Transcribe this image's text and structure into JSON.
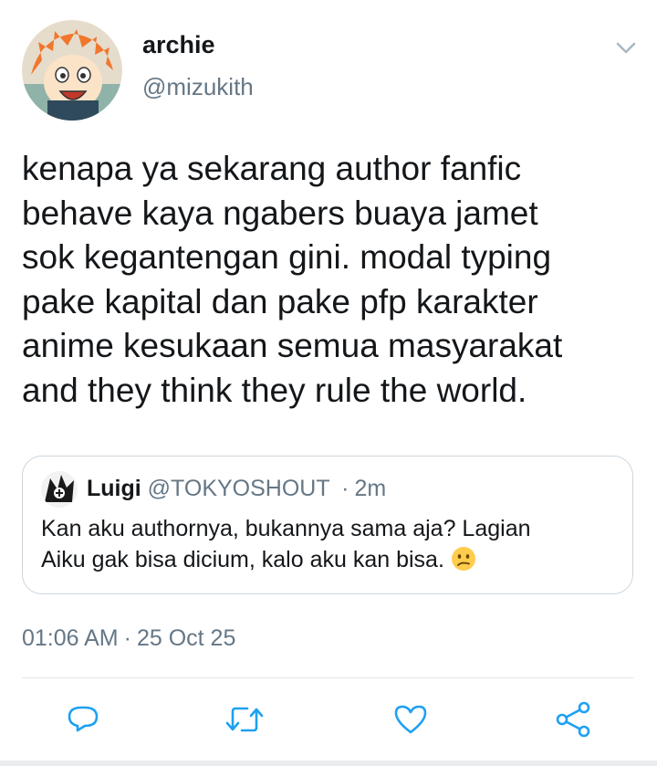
{
  "author": {
    "display_name": "archie",
    "handle": "@mizukith"
  },
  "tweet": {
    "text": "kenapa ya sekarang author fanfic\nbehave kaya ngabers buaya jamet\nsok kegantengan gini. modal typing\npake kapital dan pake pfp karakter\nanime kesukaan semua masyarakat\nand they think they rule the world.",
    "time": "01:06 AM",
    "meta_sep": "·",
    "date": "25 Oct 25"
  },
  "quoted": {
    "name": "Luigi",
    "handle": "@TOKYOSHOUT",
    "sep": "·",
    "age": "2m",
    "text": "Kan aku authornya, bukannya sama aja? Lagian\nAiku gak bisa dicium, kalo aku kan bisa. ",
    "emoji": "confused-face-emoji"
  },
  "actions": {
    "reply_icon": "reply-icon",
    "retweet_icon": "retweet-icon",
    "like_icon": "heart-icon",
    "share_icon": "share-icon"
  },
  "colors": {
    "text": "#14171a",
    "secondary": "#657786",
    "icon": "#1da1f2",
    "border": "#ccd6dd"
  }
}
